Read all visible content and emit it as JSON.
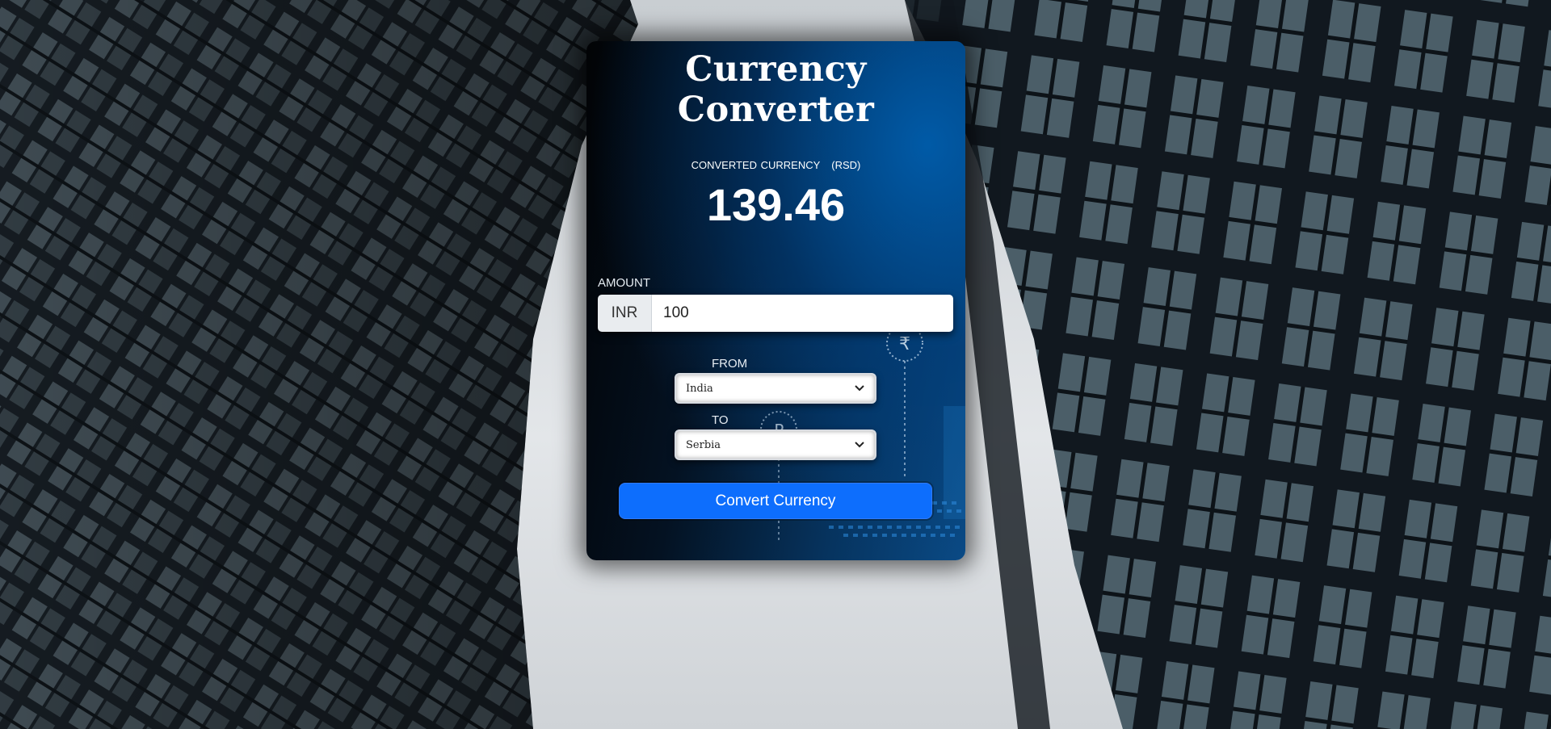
{
  "app": {
    "title": "Currency Converter"
  },
  "result": {
    "label": "CONVERTED CURRENCY",
    "currency_code": "(RSD)",
    "value": "139.46"
  },
  "amount": {
    "label": "AMOUNT",
    "prefix": "INR",
    "value": "100"
  },
  "from": {
    "label": "FROM",
    "selected": "India"
  },
  "to": {
    "label": "TO",
    "selected": "Serbia"
  },
  "button": {
    "label": "Convert Currency"
  },
  "colors": {
    "accent": "#0d6efd",
    "card_dark": "#041222",
    "card_blue": "#0a4a85"
  },
  "icons": {
    "dropdown": "chevron-down-icon"
  }
}
